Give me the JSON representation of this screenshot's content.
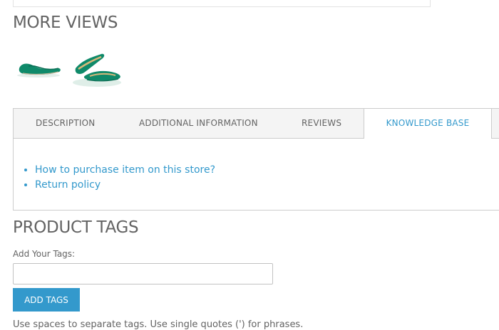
{
  "more_views": {
    "title": "MORE VIEWS",
    "thumbnails": [
      {
        "icon": "green-flat-shoe-side-view",
        "color": "#0f8a6a"
      },
      {
        "icon": "green-flat-shoe-pair-view",
        "color": "#0f8a6a"
      }
    ]
  },
  "tabs": {
    "description": "DESCRIPTION",
    "additional_information": "ADDITIONAL INFORMATION",
    "reviews": "REVIEWS",
    "knowledge_base": "KNOWLEDGE BASE",
    "active": "knowledge_base"
  },
  "knowledge_base_links": [
    "How to purchase item on this store?",
    "Return policy"
  ],
  "product_tags": {
    "title": "PRODUCT TAGS",
    "label": "Add Your Tags:",
    "input_value": "",
    "button_label": "ADD TAGS",
    "help_text": "Use spaces to separate tags. Use single quotes (') for phrases."
  },
  "colors": {
    "accent": "#3399cc",
    "text": "#636363",
    "tab_bar": "#f4f4f4",
    "border": "#cccccc"
  }
}
